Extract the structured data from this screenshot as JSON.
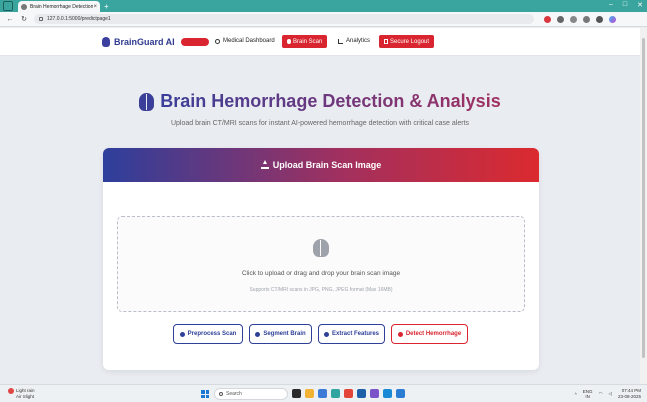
{
  "browser": {
    "tab_title": "Brain Hemorrhage Detection - E",
    "tab_close": "×",
    "new_tab": "+",
    "url": "127.0.0.1:5000/predictpage1",
    "back": "←",
    "reload": "↻",
    "window_controls": [
      "–",
      "□",
      "✕"
    ]
  },
  "nav": {
    "brand": "BrainGuard AI",
    "links": [
      {
        "label": "Medical Dashboard",
        "icon": "info-circle-icon"
      },
      {
        "label": "Brain Scan",
        "icon": "brain-icon",
        "active": true
      },
      {
        "label": "Analytics",
        "icon": "chart-line-icon"
      },
      {
        "label": "Secure Logout",
        "icon": "logout-icon"
      }
    ]
  },
  "hero": {
    "title": "Brain Hemorrhage Detection & Analysis",
    "subtitle": "Upload brain CT/MRI scans for instant AI-powered hemorrhage detection with critical case alerts"
  },
  "upload": {
    "header": "Upload Brain Scan Image",
    "dropzone_text": "Click to upload or drag and drop your brain scan image",
    "dropzone_hint": "Supports CT/MRI scans in JPG, PNG, JPEG format (Max 16MB)"
  },
  "actions": [
    {
      "label": "Preprocess Scan",
      "icon": "gear-icon"
    },
    {
      "label": "Segment Brain",
      "icon": "scissors-icon"
    },
    {
      "label": "Extract Features",
      "icon": "search-icon"
    },
    {
      "label": "Detect Hemorrhage",
      "icon": "heart-pulse-icon"
    }
  ],
  "taskbar": {
    "weather_title": "Light rain",
    "weather_sub": "Air Slight",
    "search": "Search",
    "lang": "ENG",
    "lang_sub": "IN",
    "time": "07:44 PM",
    "date": "23-08-2025"
  },
  "colors": {
    "brand": "#2f3a8f",
    "danger": "#d9252f",
    "accent_gradient_start": "#2d3f9c",
    "accent_gradient_end": "#db2a2f"
  }
}
